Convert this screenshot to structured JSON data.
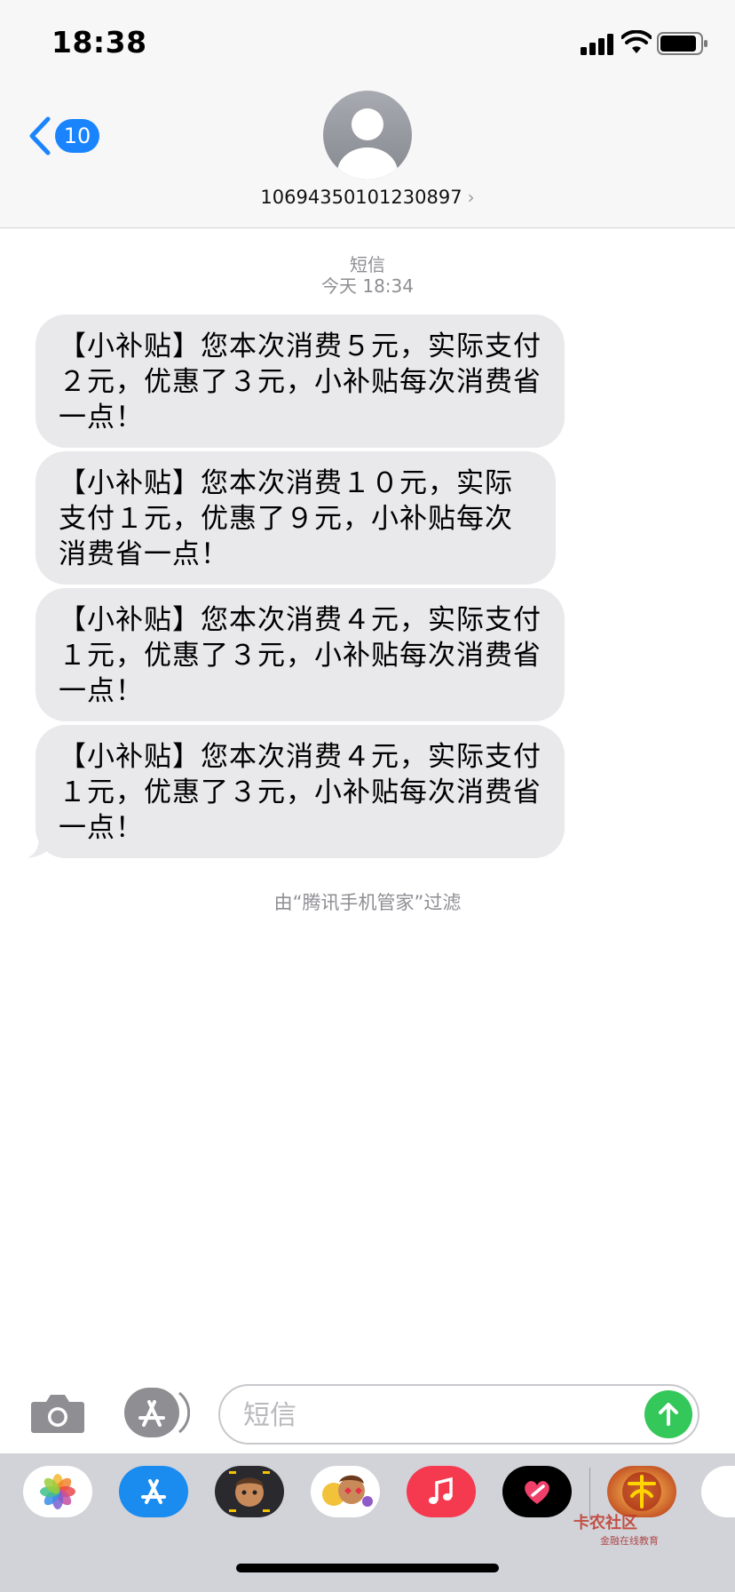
{
  "status_bar": {
    "time": "18:38"
  },
  "header": {
    "back_count": "10",
    "contact_number": "10694350101230897",
    "chevron": "›"
  },
  "thread": {
    "service_label": "短信",
    "timestamp": "今天 18:34",
    "messages": [
      "【小补贴】您本次消费５元，实际支付２元，优惠了３元，小补贴每次消费省一点！",
      "【小补贴】您本次消费１０元，实际支付１元，优惠了９元，小补贴每次消费省一点！",
      "【小补贴】您本次消费４元，实际支付１元，优惠了３元，小补贴每次消费省一点！",
      "【小补贴】您本次消费４元，实际支付１元，优惠了３元，小补贴每次消费省一点！"
    ],
    "filter_note": "由“腾讯手机管家”过滤"
  },
  "composer": {
    "placeholder": "短信"
  },
  "app_tray": {
    "apps": [
      "photos-icon",
      "app-store-icon",
      "memoji-icon",
      "animoji-icon",
      "music-icon",
      "digital-touch-icon",
      "game-icon"
    ],
    "watermark_title": "卡农社区",
    "watermark_sub": "金融在线教育"
  },
  "colors": {
    "accent": "#1a84ff",
    "bubble": "#e9e9eb",
    "send": "#34c759",
    "meta": "#8e8e93"
  }
}
